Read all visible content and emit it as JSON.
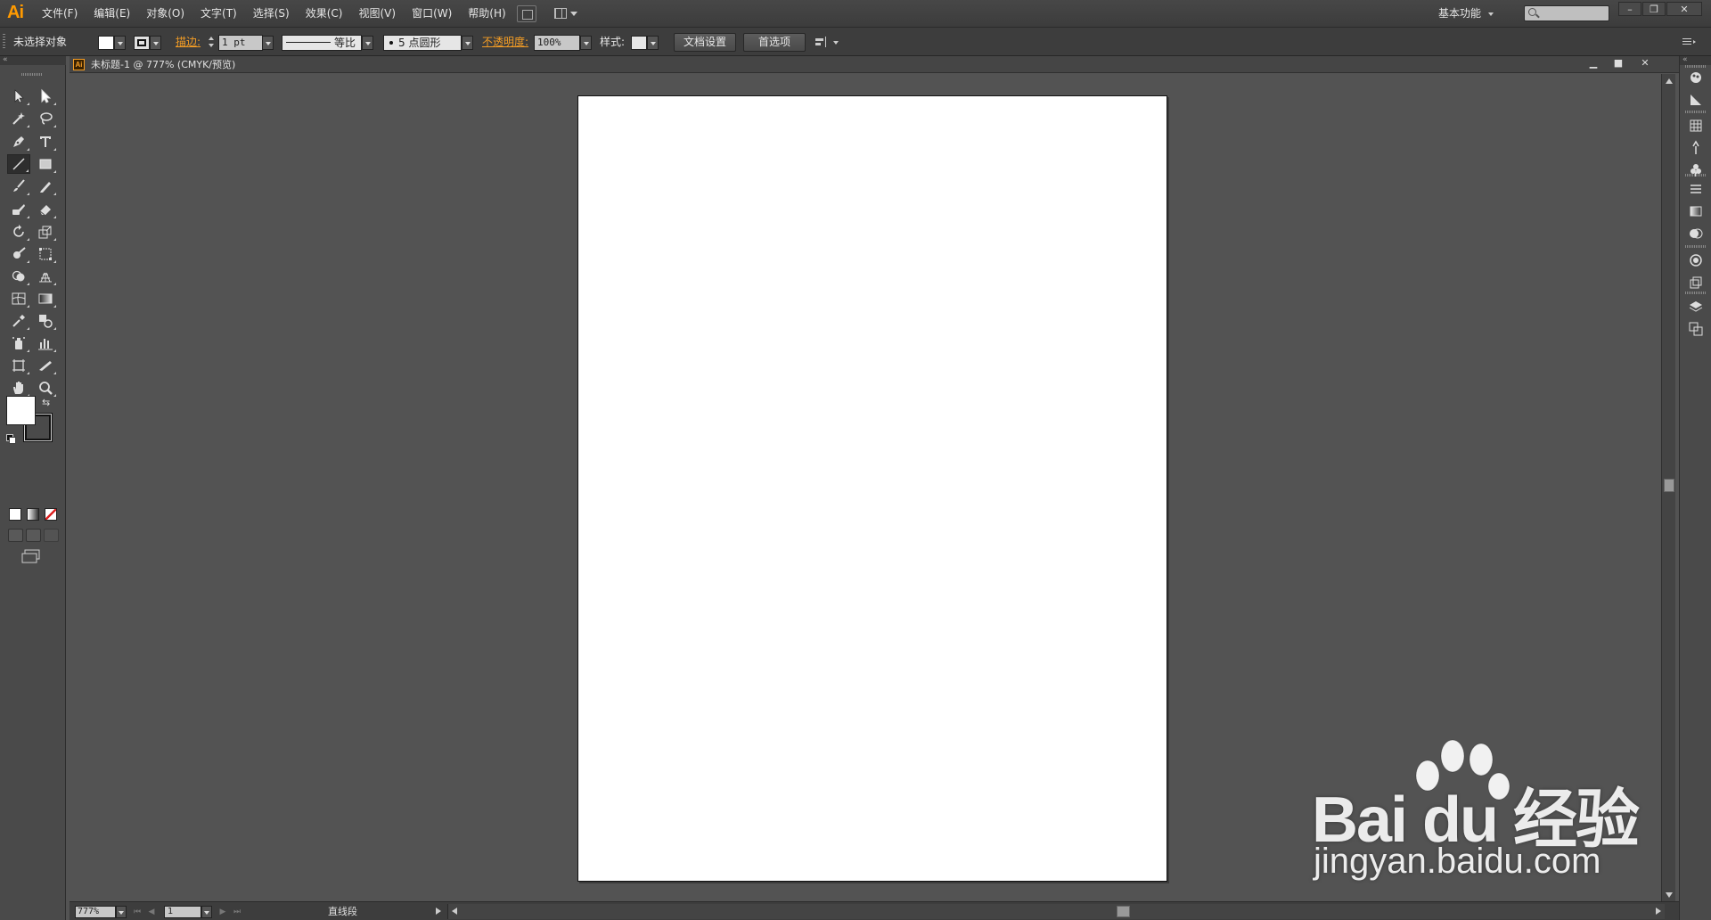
{
  "app": {
    "logo_text": "Ai",
    "menus": [
      "文件(F)",
      "编辑(E)",
      "对象(O)",
      "文字(T)",
      "选择(S)",
      "效果(C)",
      "视图(V)",
      "窗口(W)",
      "帮助(H)"
    ],
    "workspace_label": "基本功能"
  },
  "control": {
    "selection_status": "未选择对象",
    "stroke_label": "描边:",
    "stroke_weight": "1 pt",
    "profile_label": "等比",
    "brush_label": "5 点圆形",
    "opacity_label": "不透明度:",
    "opacity_value": "100%",
    "style_label": "样式:",
    "doc_setup_label": "文档设置",
    "prefs_label": "首选项"
  },
  "document": {
    "title": "未标题-1 @ 777% (CMYK/预览)",
    "color_mode": "CMYK",
    "artboard_color": "#ffffff"
  },
  "status": {
    "zoom": "777%",
    "page": "1",
    "current_tool": "直线段"
  },
  "tools": [
    {
      "name": "selection-tool-icon"
    },
    {
      "name": "direct-selection-tool-icon"
    },
    {
      "name": "magic-wand-tool-icon"
    },
    {
      "name": "lasso-tool-icon"
    },
    {
      "name": "pen-tool-icon"
    },
    {
      "name": "type-tool-icon"
    },
    {
      "name": "line-segment-tool-icon",
      "active": true
    },
    {
      "name": "rectangle-tool-icon"
    },
    {
      "name": "paintbrush-tool-icon"
    },
    {
      "name": "pencil-tool-icon"
    },
    {
      "name": "blob-brush-tool-icon"
    },
    {
      "name": "eraser-tool-icon"
    },
    {
      "name": "rotate-tool-icon"
    },
    {
      "name": "scale-tool-icon"
    },
    {
      "name": "warp-tool-icon"
    },
    {
      "name": "free-transform-tool-icon"
    },
    {
      "name": "shape-builder-tool-icon"
    },
    {
      "name": "perspective-grid-tool-icon"
    },
    {
      "name": "mesh-tool-icon"
    },
    {
      "name": "gradient-tool-icon"
    },
    {
      "name": "eyedropper-tool-icon"
    },
    {
      "name": "blend-tool-icon"
    },
    {
      "name": "symbol-sprayer-tool-icon"
    },
    {
      "name": "column-graph-tool-icon"
    },
    {
      "name": "artboard-tool-icon"
    },
    {
      "name": "slice-tool-icon"
    },
    {
      "name": "hand-tool-icon"
    },
    {
      "name": "zoom-tool-icon"
    }
  ],
  "colors": {
    "fill": "#ffffff",
    "stroke": "#000000",
    "accent": "#f49d25"
  },
  "dock_panels": [
    "color-panel-icon",
    "color-guide-panel-icon",
    "swatches-panel-icon",
    "brushes-panel-icon",
    "symbols-panel-icon",
    "stroke-panel-icon",
    "gradient-panel-icon",
    "transparency-panel-icon",
    "appearance-panel-icon",
    "graphic-styles-panel-icon",
    "layers-panel-icon",
    "artboards-panel-icon"
  ],
  "watermark": {
    "brand": "Bai du 经验",
    "url": "jingyan.baidu.com"
  }
}
